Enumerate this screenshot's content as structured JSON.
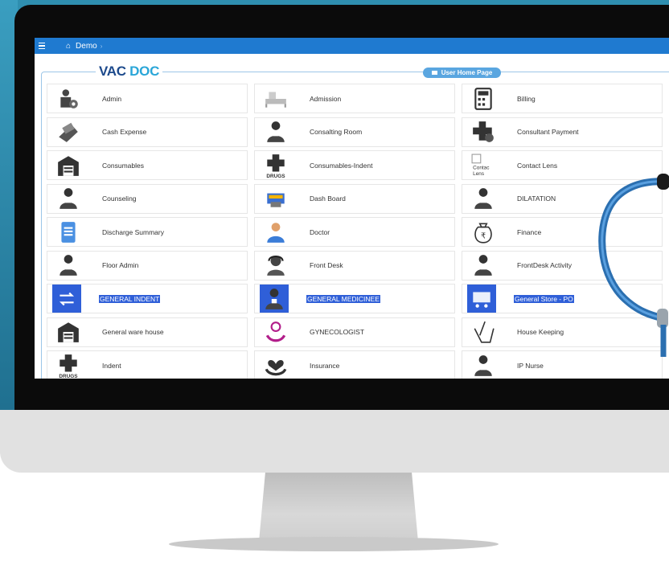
{
  "topbar": {
    "breadcrumb": "Demo"
  },
  "brand": {
    "part1": "VAC",
    "part2": "DOC"
  },
  "home_button": {
    "label": "User Home Page"
  },
  "modules": [
    {
      "label": "Admin",
      "icon": "admin-gear-icon"
    },
    {
      "label": "Admission",
      "icon": "bed-icon"
    },
    {
      "label": "Billing",
      "icon": "calculator-icon"
    },
    {
      "label": "Cash Expense",
      "icon": "cash-hand-icon"
    },
    {
      "label": "Consalting Room",
      "icon": "doctor-icon"
    },
    {
      "label": "Consultant Payment",
      "icon": "medical-cross-payment-icon"
    },
    {
      "label": "Consumables",
      "icon": "warehouse-icon"
    },
    {
      "label": "Consumables-Indent",
      "icon": "drugs-cross-icon"
    },
    {
      "label": "Contact Lens",
      "icon": "broken-image-icon",
      "alt": "Contac Lens"
    },
    {
      "label": "Counseling",
      "icon": "doctor-icon"
    },
    {
      "label": "Dash Board",
      "icon": "dashboard-icon"
    },
    {
      "label": "DILATATION",
      "icon": "doctor-icon"
    },
    {
      "label": "Discharge Summary",
      "icon": "document-icon"
    },
    {
      "label": "Doctor",
      "icon": "doctor-avatar-icon"
    },
    {
      "label": "Finance",
      "icon": "money-bag-icon"
    },
    {
      "label": "Floor Admin",
      "icon": "doctor-icon"
    },
    {
      "label": "Front Desk",
      "icon": "receptionist-icon"
    },
    {
      "label": "FrontDesk Activity",
      "icon": "doctor-icon"
    },
    {
      "label": "GENERAL INDENT",
      "icon": "swap-arrows-icon",
      "selected": true
    },
    {
      "label": "GENERAL MEDICINEE",
      "icon": "doctor-icon",
      "selected": true
    },
    {
      "label": "General Store - PO",
      "icon": "cart-icon",
      "selected": true
    },
    {
      "label": "General ware house",
      "icon": "warehouse-icon"
    },
    {
      "label": "GYNECOLOGIST",
      "icon": "female-hands-icon"
    },
    {
      "label": "House Keeping",
      "icon": "broom-bucket-icon"
    },
    {
      "label": "Indent",
      "icon": "drugs-cross-icon"
    },
    {
      "label": "Insurance",
      "icon": "heart-hands-icon"
    },
    {
      "label": "IP Nurse",
      "icon": "doctor-icon"
    }
  ],
  "colors": {
    "topbar": "#1f7ad0",
    "selection": "#2f5fd8",
    "brand_dark": "#1d4a8c",
    "brand_light": "#2aa6d8"
  }
}
